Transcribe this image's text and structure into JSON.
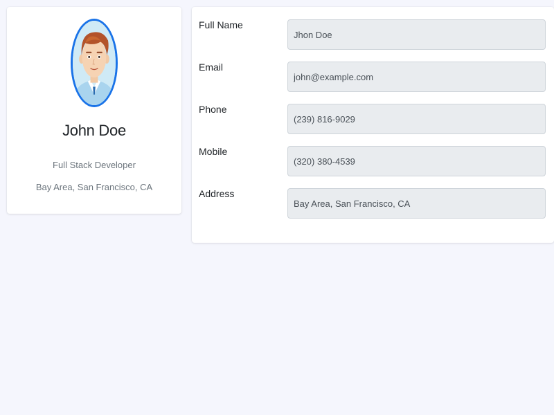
{
  "profile": {
    "name": "John Doe",
    "role": "Full Stack Developer",
    "location": "Bay Area, San Francisco, CA",
    "avatar_icon": "user-avatar-icon",
    "avatar_border_color": "#1a73e8"
  },
  "details": {
    "fields": [
      {
        "label": "Full Name",
        "value": "Jhon Doe"
      },
      {
        "label": "Email",
        "value": "john@example.com"
      },
      {
        "label": "Phone",
        "value": "(239) 816-9029"
      },
      {
        "label": "Mobile",
        "value": "(320) 380-4539"
      },
      {
        "label": "Address",
        "value": "Bay Area, San Francisco, CA"
      }
    ]
  },
  "colors": {
    "page_background": "#f5f6fd",
    "card_background": "#ffffff",
    "field_background": "#e9ecef",
    "muted_text": "#6c757d"
  }
}
